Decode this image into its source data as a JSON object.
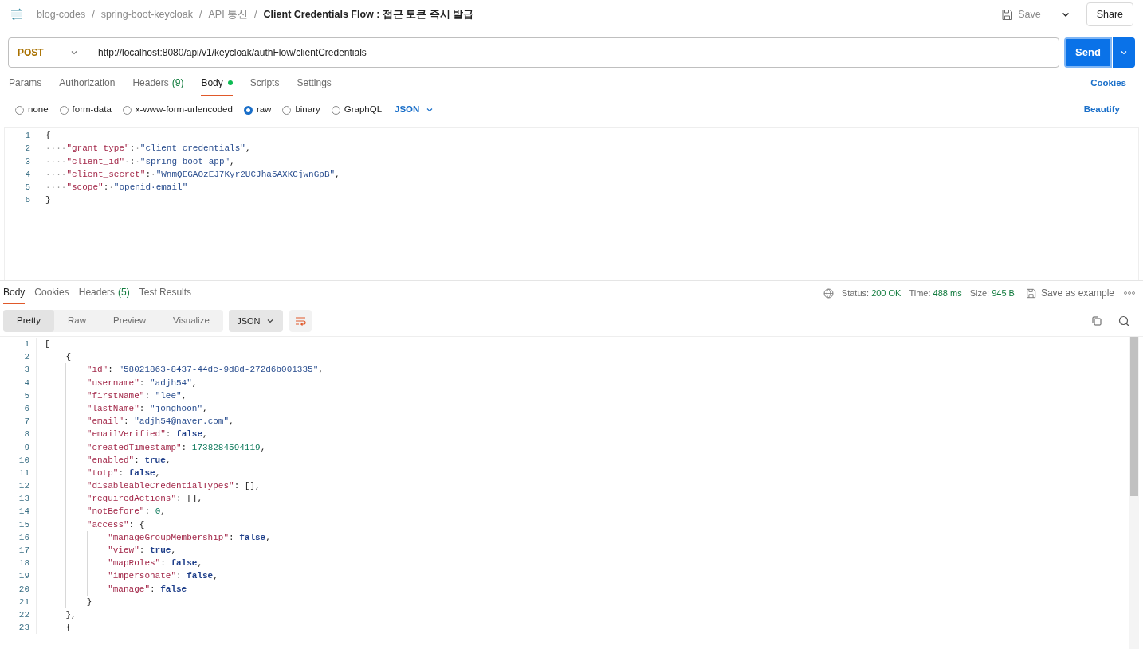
{
  "breadcrumb": {
    "items": [
      "blog-codes",
      "spring-boot-keycloak",
      "API 통신"
    ],
    "separator": "/",
    "current": "Client Credentials Flow : 접근 토큰 즉시 발급"
  },
  "header_actions": {
    "save": "Save",
    "share": "Share"
  },
  "request": {
    "method": "POST",
    "url": "http://localhost:8080/api/v1/keycloak/authFlow/clientCredentials",
    "send": "Send"
  },
  "request_tabs": [
    {
      "label": "Params",
      "selected": false
    },
    {
      "label": "Authorization",
      "selected": false
    },
    {
      "label": "Headers",
      "count": "(9)",
      "selected": false
    },
    {
      "label": "Body",
      "dot": true,
      "selected": true
    },
    {
      "label": "Scripts",
      "selected": false
    },
    {
      "label": "Settings",
      "selected": false
    }
  ],
  "cookies_link": "Cookies",
  "body_types": [
    {
      "label": "none",
      "selected": false
    },
    {
      "label": "form-data",
      "selected": false
    },
    {
      "label": "x-www-form-urlencoded",
      "selected": false
    },
    {
      "label": "raw",
      "selected": true
    },
    {
      "label": "binary",
      "selected": false
    },
    {
      "label": "GraphQL",
      "selected": false
    }
  ],
  "body_format": "JSON",
  "beautify": "Beautify",
  "request_body": [
    {
      "n": "1",
      "tokens": [
        {
          "kind": "punct",
          "text": "{"
        }
      ]
    },
    {
      "n": "2",
      "tokens": [
        {
          "kind": "space",
          "text": "····"
        },
        {
          "kind": "key",
          "text": "\"grant_type\""
        },
        {
          "kind": "punct",
          "text": ":"
        },
        {
          "kind": "space",
          "text": "·"
        },
        {
          "kind": "string",
          "text": "\"client_credentials\""
        },
        {
          "kind": "punct",
          "text": ","
        }
      ]
    },
    {
      "n": "3",
      "tokens": [
        {
          "kind": "space",
          "text": "····"
        },
        {
          "kind": "key",
          "text": "\"client_id\""
        },
        {
          "kind": "space",
          "text": "·"
        },
        {
          "kind": "punct",
          "text": ":"
        },
        {
          "kind": "space",
          "text": "·"
        },
        {
          "kind": "string",
          "text": "\"spring-boot-app\""
        },
        {
          "kind": "punct",
          "text": ","
        }
      ]
    },
    {
      "n": "4",
      "tokens": [
        {
          "kind": "space",
          "text": "····"
        },
        {
          "kind": "key",
          "text": "\"client_secret\""
        },
        {
          "kind": "punct",
          "text": ":"
        },
        {
          "kind": "space",
          "text": "·"
        },
        {
          "kind": "string",
          "text": "\"WnmQEGAOzEJ7Kyr2UCJha5AXKCjwnGpB\""
        },
        {
          "kind": "punct",
          "text": ","
        }
      ]
    },
    {
      "n": "5",
      "tokens": [
        {
          "kind": "space",
          "text": "····"
        },
        {
          "kind": "key",
          "text": "\"scope\""
        },
        {
          "kind": "punct",
          "text": ":"
        },
        {
          "kind": "space",
          "text": "·"
        },
        {
          "kind": "string",
          "text": "\"openid·email\""
        }
      ]
    },
    {
      "n": "6",
      "tokens": [
        {
          "kind": "punct",
          "text": "}"
        }
      ]
    }
  ],
  "response_tabs": [
    {
      "label": "Body",
      "selected": true
    },
    {
      "label": "Cookies",
      "selected": false
    },
    {
      "label": "Headers",
      "count": "(5)",
      "selected": false
    },
    {
      "label": "Test Results",
      "selected": false
    }
  ],
  "response_meta": {
    "status_label": "Status:",
    "status": "200 OK",
    "time_label": "Time:",
    "time": "488 ms",
    "size_label": "Size:",
    "size": "945 B",
    "save_example": "Save as example"
  },
  "view_modes": [
    {
      "label": "Pretty",
      "selected": true
    },
    {
      "label": "Raw",
      "selected": false
    },
    {
      "label": "Preview",
      "selected": false
    },
    {
      "label": "Visualize",
      "selected": false
    }
  ],
  "response_format": "JSON",
  "response_body": [
    {
      "n": "1",
      "tokens": [
        {
          "kind": "punct",
          "text": "["
        }
      ],
      "children": [
        {
          "n": "2",
          "tokens": [
            {
              "kind": "punct",
              "text": "{"
            }
          ],
          "children": [
            {
              "n": "3",
              "tokens": [
                {
                  "kind": "key",
                  "text": "\"id\""
                },
                {
                  "kind": "punct",
                  "text": ":"
                },
                {
                  "kind": "string",
                  "text": "\"58021863-8437-44de-9d8d-272d6b001335\""
                },
                {
                  "kind": "punct",
                  "text": ","
                }
              ]
            },
            {
              "n": "4",
              "tokens": [
                {
                  "kind": "key",
                  "text": "\"username\""
                },
                {
                  "kind": "punct",
                  "text": ":"
                },
                {
                  "kind": "string",
                  "text": "\"adjh54\""
                },
                {
                  "kind": "punct",
                  "text": ","
                }
              ]
            },
            {
              "n": "5",
              "tokens": [
                {
                  "kind": "key",
                  "text": "\"firstName\""
                },
                {
                  "kind": "punct",
                  "text": ":"
                },
                {
                  "kind": "string",
                  "text": "\"lee\""
                },
                {
                  "kind": "punct",
                  "text": ","
                }
              ]
            },
            {
              "n": "6",
              "tokens": [
                {
                  "kind": "key",
                  "text": "\"lastName\""
                },
                {
                  "kind": "punct",
                  "text": ":"
                },
                {
                  "kind": "string",
                  "text": "\"jonghoon\""
                },
                {
                  "kind": "punct",
                  "text": ","
                }
              ]
            },
            {
              "n": "7",
              "tokens": [
                {
                  "kind": "key",
                  "text": "\"email\""
                },
                {
                  "kind": "punct",
                  "text": ":"
                },
                {
                  "kind": "string",
                  "text": "\"adjh54@naver.com\""
                },
                {
                  "kind": "punct",
                  "text": ","
                }
              ]
            },
            {
              "n": "8",
              "tokens": [
                {
                  "kind": "key",
                  "text": "\"emailVerified\""
                },
                {
                  "kind": "punct",
                  "text": ":"
                },
                {
                  "kind": "keyword",
                  "text": "false"
                },
                {
                  "kind": "punct",
                  "text": ","
                }
              ]
            },
            {
              "n": "9",
              "tokens": [
                {
                  "kind": "key",
                  "text": "\"createdTimestamp\""
                },
                {
                  "kind": "punct",
                  "text": ":"
                },
                {
                  "kind": "number",
                  "text": "1738284594119"
                },
                {
                  "kind": "punct",
                  "text": ","
                }
              ]
            },
            {
              "n": "10",
              "tokens": [
                {
                  "kind": "key",
                  "text": "\"enabled\""
                },
                {
                  "kind": "punct",
                  "text": ":"
                },
                {
                  "kind": "keyword",
                  "text": "true"
                },
                {
                  "kind": "punct",
                  "text": ","
                }
              ]
            },
            {
              "n": "11",
              "tokens": [
                {
                  "kind": "key",
                  "text": "\"totp\""
                },
                {
                  "kind": "punct",
                  "text": ":"
                },
                {
                  "kind": "keyword",
                  "text": "false"
                },
                {
                  "kind": "punct",
                  "text": ","
                }
              ]
            },
            {
              "n": "12",
              "tokens": [
                {
                  "kind": "key",
                  "text": "\"disableableCredentialTypes\""
                },
                {
                  "kind": "punct",
                  "text": ":"
                },
                {
                  "kind": "punct",
                  "text": "[],"
                }
              ]
            },
            {
              "n": "13",
              "tokens": [
                {
                  "kind": "key",
                  "text": "\"requiredActions\""
                },
                {
                  "kind": "punct",
                  "text": ":"
                },
                {
                  "kind": "punct",
                  "text": "[],"
                }
              ]
            },
            {
              "n": "14",
              "tokens": [
                {
                  "kind": "key",
                  "text": "\"notBefore\""
                },
                {
                  "kind": "punct",
                  "text": ":"
                },
                {
                  "kind": "number",
                  "text": "0"
                },
                {
                  "kind": "punct",
                  "text": ","
                }
              ]
            },
            {
              "n": "15",
              "tokens": [
                {
                  "kind": "key",
                  "text": "\"access\""
                },
                {
                  "kind": "punct",
                  "text": ":"
                },
                {
                  "kind": "punct",
                  "text": "{"
                }
              ],
              "children": [
                {
                  "n": "16",
                  "tokens": [
                    {
                      "kind": "key",
                      "text": "\"manageGroupMembership\""
                    },
                    {
                      "kind": "punct",
                      "text": ":"
                    },
                    {
                      "kind": "keyword",
                      "text": "false"
                    },
                    {
                      "kind": "punct",
                      "text": ","
                    }
                  ]
                },
                {
                  "n": "17",
                  "tokens": [
                    {
                      "kind": "key",
                      "text": "\"view\""
                    },
                    {
                      "kind": "punct",
                      "text": ":"
                    },
                    {
                      "kind": "keyword",
                      "text": "true"
                    },
                    {
                      "kind": "punct",
                      "text": ","
                    }
                  ]
                },
                {
                  "n": "18",
                  "tokens": [
                    {
                      "kind": "key",
                      "text": "\"mapRoles\""
                    },
                    {
                      "kind": "punct",
                      "text": ":"
                    },
                    {
                      "kind": "keyword",
                      "text": "false"
                    },
                    {
                      "kind": "punct",
                      "text": ","
                    }
                  ]
                },
                {
                  "n": "19",
                  "tokens": [
                    {
                      "kind": "key",
                      "text": "\"impersonate\""
                    },
                    {
                      "kind": "punct",
                      "text": ":"
                    },
                    {
                      "kind": "keyword",
                      "text": "false"
                    },
                    {
                      "kind": "punct",
                      "text": ","
                    }
                  ]
                },
                {
                  "n": "20",
                  "tokens": [
                    {
                      "kind": "key",
                      "text": "\"manage\""
                    },
                    {
                      "kind": "punct",
                      "text": ":"
                    },
                    {
                      "kind": "keyword",
                      "text": "false"
                    }
                  ]
                }
              ]
            },
            {
              "n": "21",
              "tokens": [
                {
                  "kind": "punct",
                  "text": "}"
                }
              ]
            }
          ]
        },
        {
          "n": "22",
          "tokens": [
            {
              "kind": "punct",
              "text": "},"
            }
          ]
        },
        {
          "n": "23",
          "tokens": [
            {
              "kind": "punct",
              "text": "{"
            }
          ]
        }
      ]
    }
  ]
}
